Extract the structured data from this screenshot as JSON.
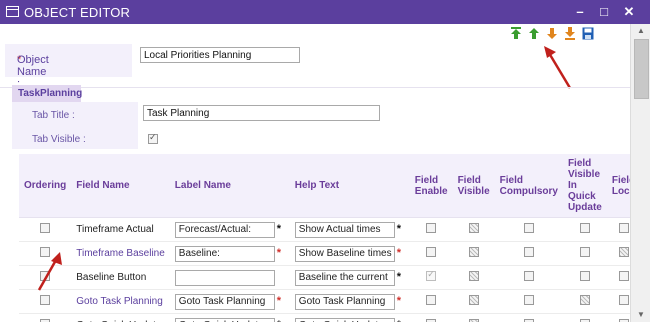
{
  "window": {
    "title": "OBJECT EDITOR",
    "controls": {
      "minimize": "–",
      "maximize": "□",
      "close": "✕"
    }
  },
  "toolbar": {
    "icons": [
      "move-top-icon",
      "move-up-icon",
      "move-down-icon",
      "move-bottom-icon",
      "save-icon"
    ],
    "colors": {
      "green": "#3a9d2f",
      "orange": "#e0851e",
      "blue": "#1f5fb4"
    }
  },
  "object": {
    "required_marker": "*",
    "name_label": "Object Name :",
    "name_value": "Local Priorities Planning"
  },
  "tab_section": {
    "tab_label": "TaskPlanning",
    "tab_title_label": "Tab Title :",
    "tab_title_value": "Task Planning",
    "tab_visible_label": "Tab Visible :",
    "tab_visible_checked": true
  },
  "grid": {
    "headers": [
      "Ordering",
      "Field Name",
      "Label Name",
      "Help Text",
      "Field Enable",
      "Field Visible",
      "Field Compulsory",
      "Field Visible In Quick Update",
      "Field Lock"
    ],
    "rows": [
      {
        "field_name": "Timeframe Actual",
        "link": false,
        "label": "Forecast/Actual:",
        "label_star": "*",
        "label_star_color": "black",
        "help": "Show Actual times",
        "help_star": "*",
        "help_star_color": "black",
        "enable": "off",
        "visible": "pattern",
        "compulsory": "off",
        "quick": "off",
        "lock": "off"
      },
      {
        "field_name": "Timeframe Baseline",
        "link": true,
        "label": "Baseline:",
        "label_star": "*",
        "label_star_color": "red",
        "help": "Show Baseline times",
        "help_star": "*",
        "help_star_color": "red",
        "enable": "off",
        "visible": "pattern",
        "compulsory": "off",
        "quick": "off",
        "lock": "pattern"
      },
      {
        "field_name": "Baseline Button",
        "link": false,
        "label": "",
        "label_star": "",
        "label_star_color": "black",
        "help": "Baseline the current",
        "help_star": "*",
        "help_star_color": "black",
        "enable": "on-dis",
        "visible": "pattern",
        "compulsory": "off",
        "quick": "off",
        "lock": "off"
      },
      {
        "field_name": "Goto Task Planning",
        "link": true,
        "label": "Goto Task Planning",
        "label_star": "*",
        "label_star_color": "red",
        "help": "Goto Task Planning",
        "help_star": "*",
        "help_star_color": "red",
        "enable": "off",
        "visible": "pattern",
        "compulsory": "off",
        "quick": "pattern",
        "lock": "off"
      },
      {
        "field_name": "Goto Quick Update",
        "link": false,
        "label": "Goto Quick Update",
        "label_star": "*",
        "label_star_color": "black",
        "help": "Goto Quick Update",
        "help_star": "*",
        "help_star_color": "black",
        "enable": "off",
        "visible": "pattern",
        "compulsory": "off",
        "quick": "off",
        "lock": "off"
      }
    ]
  }
}
